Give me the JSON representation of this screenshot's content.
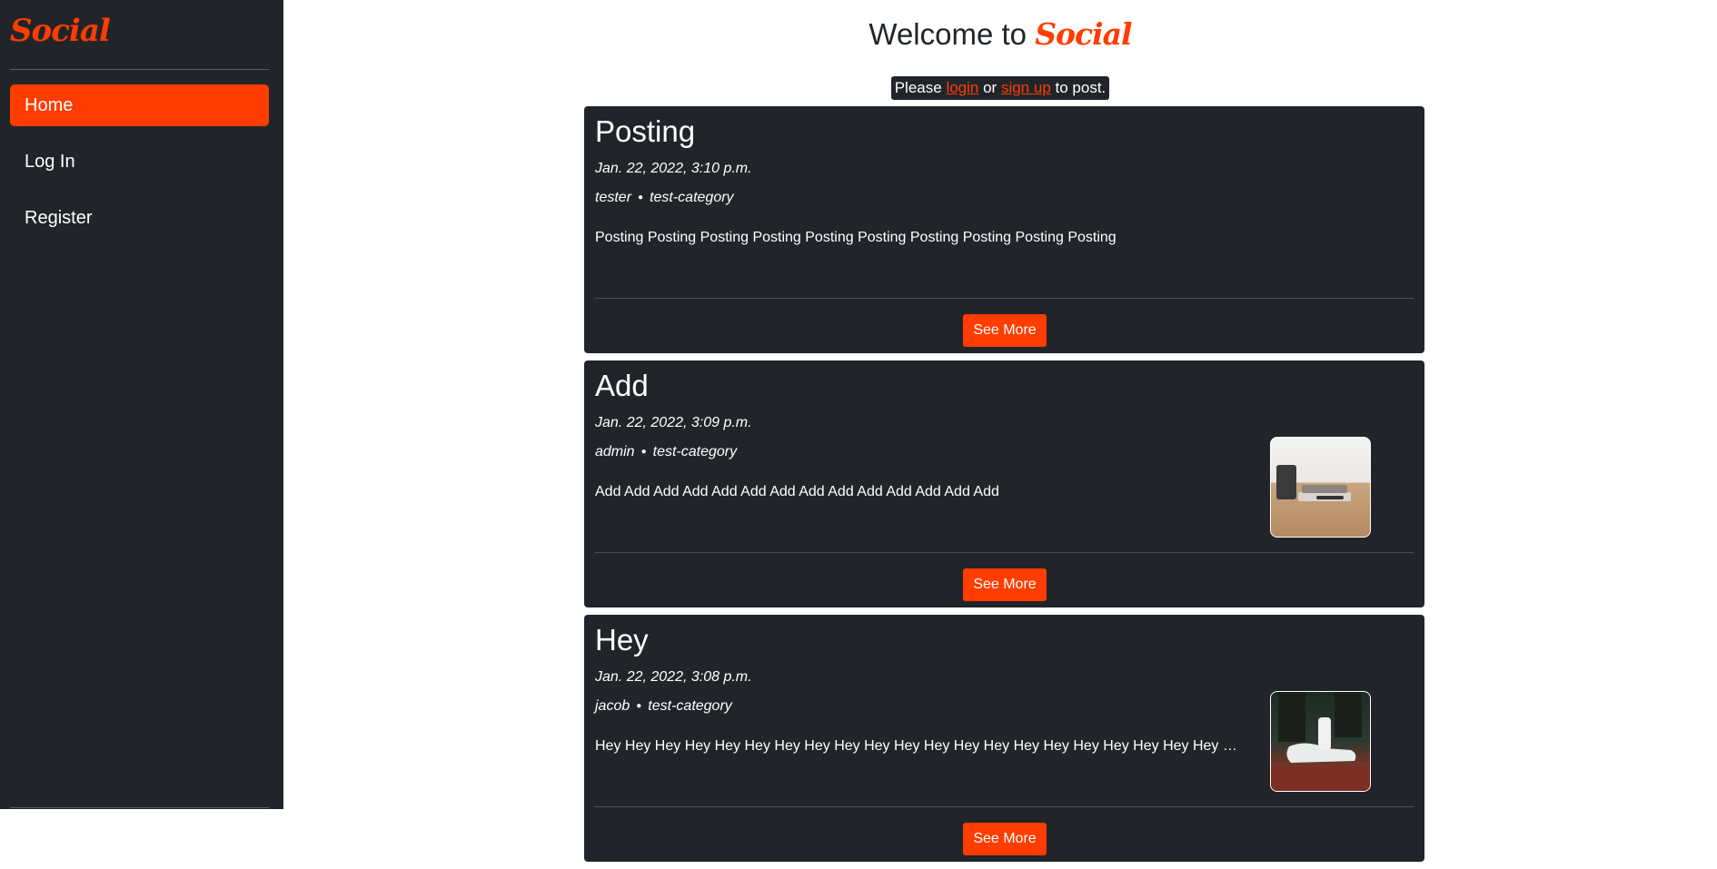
{
  "sidebar": {
    "brand": "Social",
    "nav": [
      {
        "label": "Home",
        "active": true
      },
      {
        "label": "Log In",
        "active": false
      },
      {
        "label": "Register",
        "active": false
      }
    ]
  },
  "header": {
    "welcome_prefix": "Welcome to",
    "welcome_brand": "Social"
  },
  "notice": {
    "please": "Please",
    "login_link": "login",
    "or": "or",
    "signup_link": "sign up",
    "to_post": "to post."
  },
  "posts": [
    {
      "title": "Posting",
      "date": "Jan. 22, 2022, 3:10 p.m.",
      "author": "tester",
      "category": "test-category",
      "body": "Posting Posting Posting Posting Posting Posting Posting Posting Posting Posting",
      "has_image": false,
      "see_more": "See More"
    },
    {
      "title": "Add",
      "date": "Jan. 22, 2022, 3:09 p.m.",
      "author": "admin",
      "category": "test-category",
      "body": "Add Add Add Add Add Add Add Add Add Add Add Add Add Add",
      "has_image": true,
      "see_more": "See More"
    },
    {
      "title": "Hey",
      "date": "Jan. 22, 2022, 3:08 p.m.",
      "author": "jacob",
      "category": "test-category",
      "body": "Hey Hey Hey Hey Hey Hey Hey Hey Hey Hey Hey Hey Hey Hey Hey Hey Hey Hey Hey Hey Hey …",
      "has_image": true,
      "see_more": "See More"
    }
  ],
  "colors": {
    "accent": "#ff3d00",
    "dark": "#212529",
    "background": "#ffffff"
  }
}
